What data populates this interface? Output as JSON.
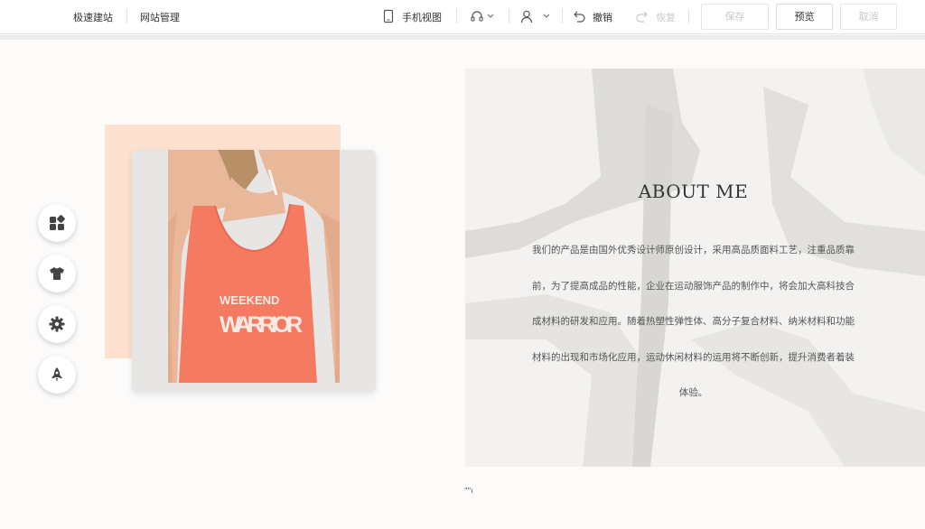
{
  "toolbar": {
    "left_items": [
      "极速建站",
      "网站管理"
    ],
    "mobile_view_label": "手机视图",
    "undo_label": "撤销",
    "redo_label": "恢复",
    "save_label": "保存",
    "preview_label": "预览",
    "cancel_label": "取消"
  },
  "sidebar": {
    "buttons": [
      {
        "icon": "widgets-icon"
      },
      {
        "icon": "shirt-icon"
      },
      {
        "icon": "gear-icon"
      },
      {
        "icon": "rocket-icon"
      }
    ]
  },
  "section": {
    "title": "ABOUT ME",
    "body": "我们的产品是由国外优秀设计师原创设计，采用高品质面料工艺，注重品质靠前，为了提高成品的性能，企业在运动服饰产品的制作中，将会加大高科技合成材料的研发和应用。随着热塑性弹性体、高分子复合材料、纳米材料和功能材料的出现和市场化应用，运动休闲材料的运用将不断创新，提升消费者着装体验。",
    "shirt_text_line1": "WEEKEND",
    "shirt_text_line2": "WARRIOR",
    "small_mark": "\"\"ı"
  },
  "colors": {
    "peach": "#fde2cf",
    "shirt": "#f47a62",
    "accent_text": "#333333"
  }
}
